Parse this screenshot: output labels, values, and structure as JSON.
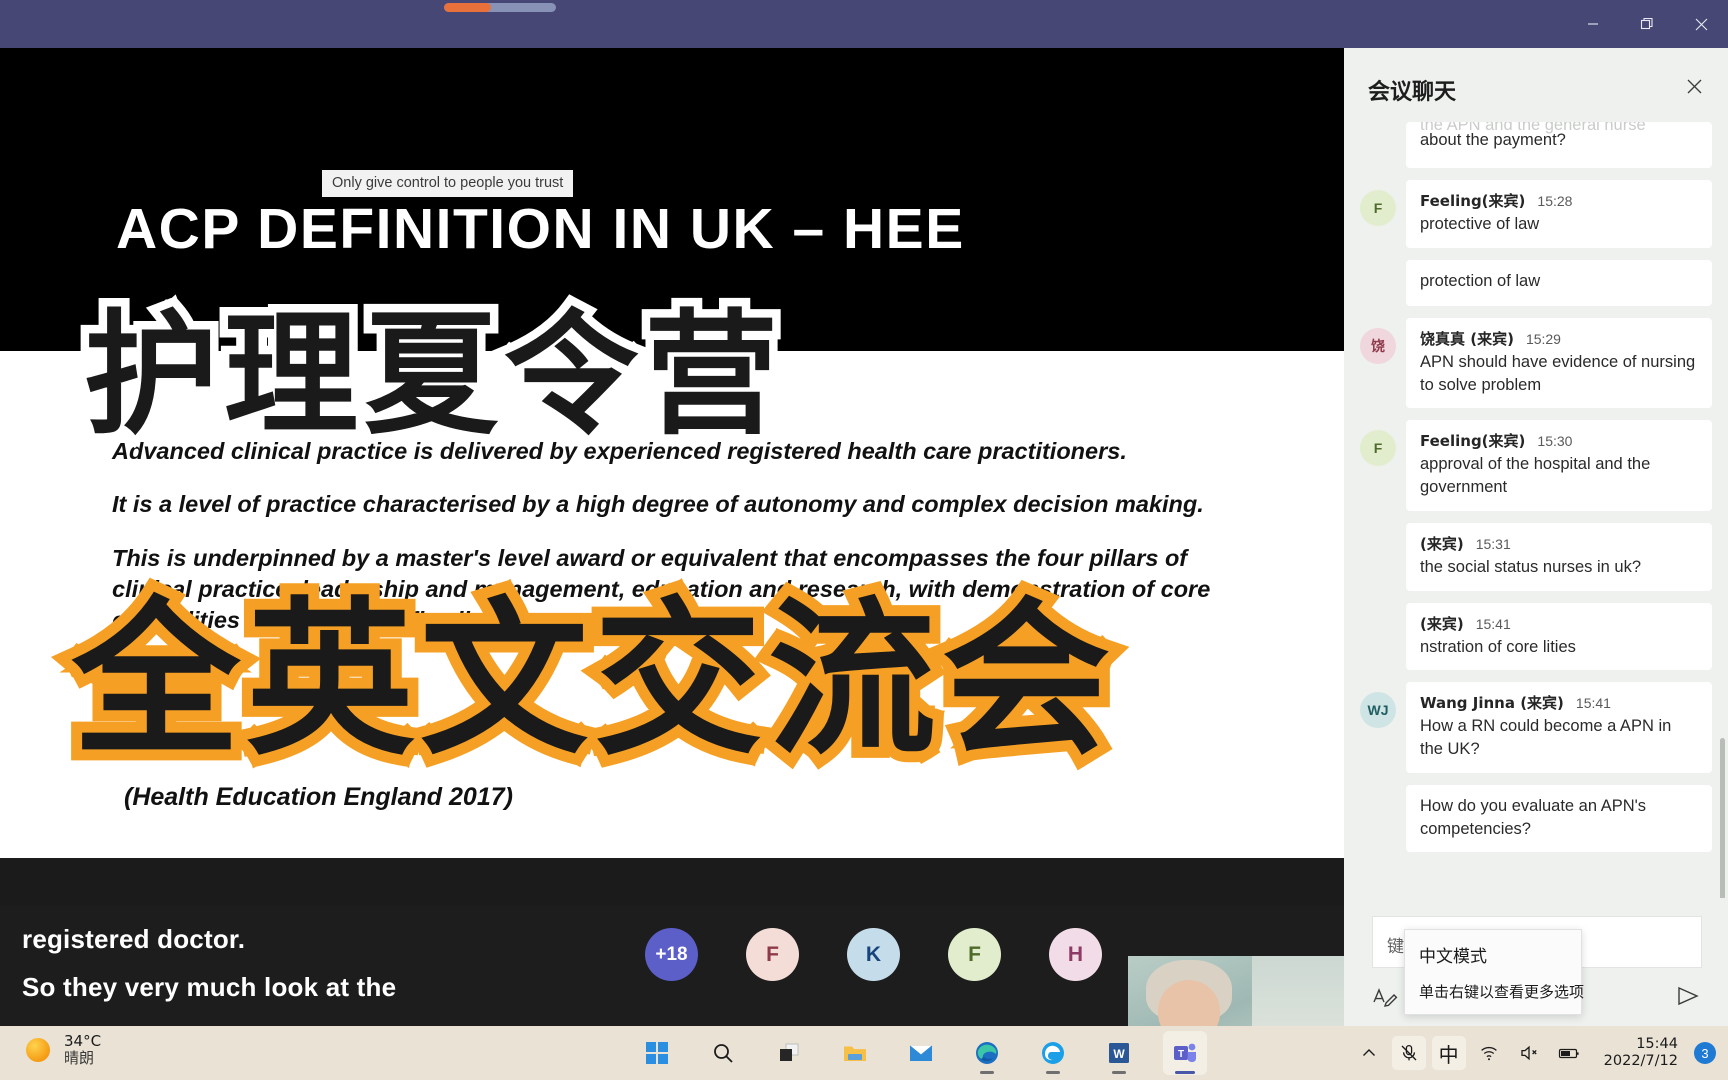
{
  "window": {
    "controls": {
      "minimize": "minimize-icon",
      "restore": "restore-icon",
      "close": "close-icon"
    },
    "progress_percent": 42
  },
  "stage": {
    "control_toast": "Only give control to people you trust",
    "slide": {
      "title": "ACP DEFINITION IN UK – HEE",
      "paragraphs": [
        "Advanced clinical practice is delivered by experienced registered health care practitioners.",
        "It is a level of practice characterised by a high degree of autonomy and complex decision making.",
        "This is underpinned by a master's level award or equivalent that encompasses the four pillars of clinical practice, leadership and management, education and research, with demonstration of core capabilities and area specific clinical competence."
      ],
      "credit": "(Health Education England 2017)"
    },
    "overlay_text": {
      "line1": "护理夏令营",
      "line2": "全英文交流会",
      "line1_stroke_color": "#ffffff",
      "line2_stroke_color": "#f5a024"
    },
    "captions": [
      "registered doctor.",
      "So they very much look at the"
    ],
    "participants": [
      {
        "label": "+18",
        "bg": "#5b5fc7",
        "fg": "#ffffff",
        "name": "overflow-count"
      },
      {
        "label": "F",
        "bg": "#f3ddd6",
        "fg": "#8e3a4a",
        "name": "participant-f1"
      },
      {
        "label": "K",
        "bg": "#c5dcea",
        "fg": "#17447a",
        "name": "participant-k"
      },
      {
        "label": "F",
        "bg": "#e2edcd",
        "fg": "#4f6b2a",
        "name": "participant-f2"
      },
      {
        "label": "H",
        "bg": "#f2dce7",
        "fg": "#8e3a66",
        "name": "participant-h"
      }
    ]
  },
  "chat": {
    "title": "会议聊天",
    "close_icon": "close-icon",
    "messages": [
      {
        "author": "",
        "time": "",
        "avatar": "",
        "avatar_bg": "",
        "avatar_fg": "",
        "text_clipped": "the APN and the general nurse",
        "text": "about the payment?",
        "continuation": true
      },
      {
        "author": "Feeling(来宾)",
        "time": "15:28",
        "avatar": "F",
        "avatar_bg": "#e2edcd",
        "avatar_fg": "#4f6b2a",
        "text": "protective of law",
        "continuation": false
      },
      {
        "author": "",
        "time": "",
        "avatar": "",
        "avatar_bg": "",
        "avatar_fg": "",
        "text": "protection of law",
        "continuation": true
      },
      {
        "author": "饶真真 (来宾)",
        "time": "15:29",
        "avatar": "饶",
        "avatar_bg": "#f0d6dd",
        "avatar_fg": "#8e3a4a",
        "text": "APN should have evidence of nursing to solve problem",
        "continuation": false
      },
      {
        "author": "Feeling(来宾)",
        "time": "15:30",
        "avatar": "F",
        "avatar_bg": "#e2edcd",
        "avatar_fg": "#4f6b2a",
        "text": "approval of the hospital and the government",
        "continuation": false
      },
      {
        "author": "(来宾)",
        "time": "15:31",
        "avatar": "",
        "avatar_bg": "",
        "avatar_fg": "",
        "text": "the social status nurses in uk?",
        "continuation": false,
        "justified": true
      },
      {
        "author": "(来宾)",
        "time": "15:41",
        "avatar": "",
        "avatar_bg": "",
        "avatar_fg": "",
        "text": "nstration of core lities",
        "continuation": false
      },
      {
        "author": "Wang Jinna (来宾)",
        "time": "15:41",
        "avatar": "WJ",
        "avatar_bg": "#cfe4e4",
        "avatar_fg": "#1f5f63",
        "text": "How a RN could become a APN in the UK?",
        "continuation": false
      },
      {
        "author": "",
        "time": "",
        "avatar": "",
        "avatar_bg": "",
        "avatar_fg": "",
        "text": "How do you evaluate an APN's competencies?",
        "continuation": true
      }
    ],
    "compose": {
      "placeholder": "键入新消息",
      "format_icon": "format-text-icon",
      "send_icon": "send-icon"
    },
    "ime_tooltip": {
      "title": "中文模式",
      "hint": "单击右键以查看更多选项"
    }
  },
  "taskbar": {
    "weather": {
      "temperature": "34°C",
      "condition": "晴朗",
      "icon": "sun-icon"
    },
    "apps": [
      {
        "name": "start-button",
        "icon": "windows-logo-icon",
        "running": false,
        "active": false
      },
      {
        "name": "search-button",
        "icon": "search-icon",
        "running": false,
        "active": false
      },
      {
        "name": "task-view-button",
        "icon": "task-view-icon",
        "running": false,
        "active": false
      },
      {
        "name": "file-explorer",
        "icon": "folder-icon",
        "running": false,
        "active": false
      },
      {
        "name": "mail-app",
        "icon": "mail-icon",
        "running": false,
        "active": false
      },
      {
        "name": "edge-browser",
        "icon": "edge-icon",
        "running": true,
        "active": false
      },
      {
        "name": "edge-legacy-browser",
        "icon": "edge-legacy-icon",
        "running": true,
        "active": false
      },
      {
        "name": "word-app",
        "icon": "word-icon",
        "running": true,
        "active": false
      },
      {
        "name": "teams-app",
        "icon": "teams-icon",
        "running": true,
        "active": true
      }
    ],
    "tray": {
      "overflow_icon": "chevron-up-icon",
      "mic_icon": "microphone-muted-icon",
      "ime_label": "中",
      "wifi_icon": "wifi-icon",
      "volume_icon": "speaker-muted-icon",
      "battery_icon": "battery-icon",
      "time": "15:44",
      "date": "2022/7/12",
      "notification_count": "3"
    }
  }
}
